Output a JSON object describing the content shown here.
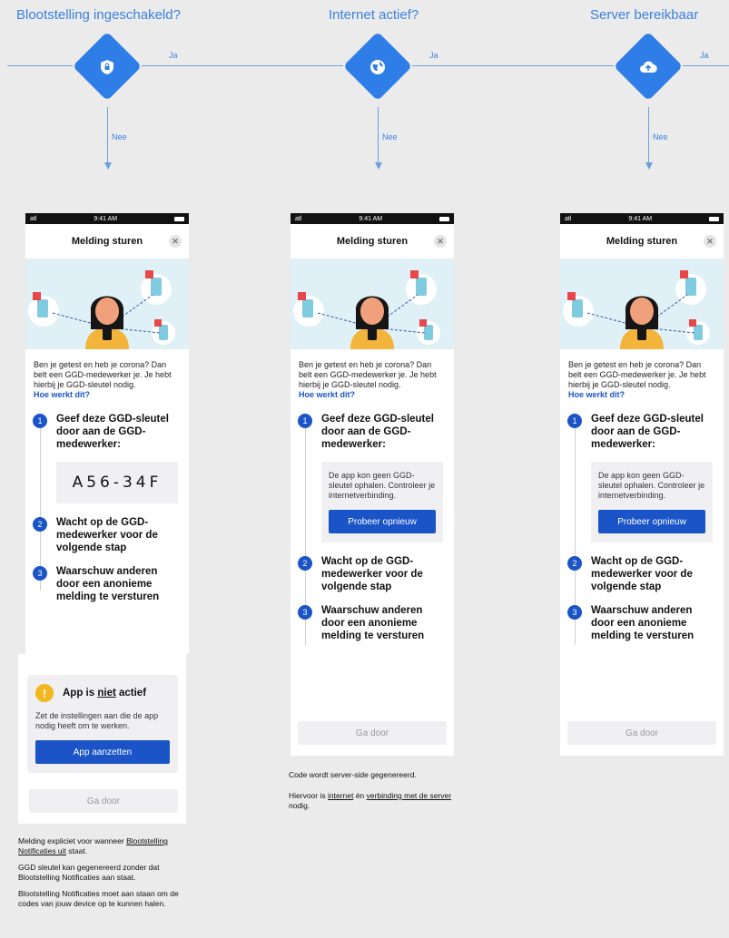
{
  "flow": {
    "checks": [
      {
        "title": "Blootstelling ingeschakeld?",
        "icon": "shield-icon"
      },
      {
        "title": "Internet actief?",
        "icon": "globe-icon"
      },
      {
        "title": "Server bereikbaar",
        "icon": "cloud-upload-icon"
      }
    ],
    "yes_label": "Ja",
    "no_label": "Nee"
  },
  "phone": {
    "time": "9:41 AM",
    "carrier": "atl",
    "sheet_title": "Melding sturen",
    "close_symbol": "✕",
    "intro_text": "Ben je getest en heb je corona? Dan belt een GGD-medewerker je. Je hebt hierbij je GGD-sleutel nodig.",
    "intro_link": "Hoe werkt dit?",
    "steps": [
      {
        "number": "1",
        "text": "Geef deze GGD-sleutel door aan de GGD-medewerker:"
      },
      {
        "number": "2",
        "text": "Wacht op de GGD-medewerker voor de volgende stap"
      },
      {
        "number": "3",
        "text": "Waarschuw anderen door een anonieme melding te versturen"
      }
    ],
    "code": "A56-34F",
    "error_text": "De app kon geen GGD-sleutel ophalen. Controleer je internetverbinding.",
    "retry_label": "Probeer opnieuw",
    "continue_label": "Ga door"
  },
  "inactive_card": {
    "title_prefix": "App is ",
    "title_emphasis": "niet",
    "title_suffix": " actief",
    "text": "Zet de instellingen aan die de app nodig heeft om te werken.",
    "button_label": "App aanzetten",
    "warning_symbol": "!"
  },
  "notes": {
    "col1": {
      "p1_a": "Melding expliciet voor wanneer ",
      "p1_link": "Blootstelling Notificaties uit",
      "p1_b": " staat.",
      "p2": "GGD sleutel kan gegenereerd zonder dat Blootstelling Notificaties aan staat.",
      "p3": "Blootstelling Notificaties moet aan staan om de codes van jouw device op te kunnen halen."
    },
    "col2": {
      "p1": "Code wordt server-side gegenereerd.",
      "p2_a": "Hiervoor is ",
      "p2_link1": "internet",
      "p2_b": " én ",
      "p2_link2": "verbinding met de server",
      "p2_c": " nodig."
    }
  },
  "colors": {
    "flow_blue": "#2f7de6",
    "button_blue": "#1a54c7",
    "warning_yellow": "#f3b71d",
    "illustration_bg": "#dff0f6"
  }
}
